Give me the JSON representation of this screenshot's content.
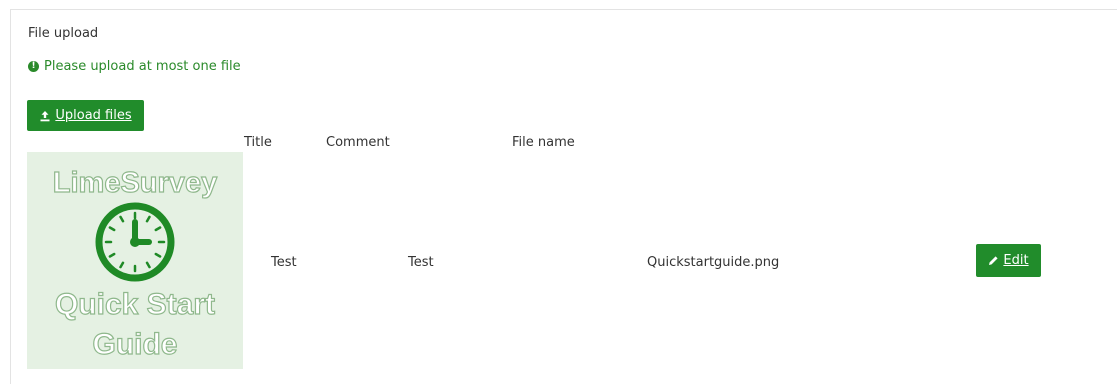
{
  "question": {
    "title": "File upload",
    "help_text": "Please upload at most one file",
    "help_icon": "exclamation-circle-icon"
  },
  "upload": {
    "button_label": "Upload files",
    "icon": "upload-icon"
  },
  "table": {
    "headers": {
      "title": "Title",
      "comment": "Comment",
      "file_name": "File name"
    },
    "rows": [
      {
        "thumbnail": {
          "line1": "LimeSurvey",
          "line2": "Quick Start",
          "line3": "Guide",
          "icon": "clock-icon"
        },
        "title": "Test",
        "comment": "Test",
        "file_name": "Quickstartguide.png",
        "edit_label": "Edit",
        "edit_icon": "pencil-icon"
      }
    ]
  },
  "colors": {
    "accent": "#218c2b",
    "help_text": "#2a8a2a",
    "thumbnail_bg": "#e5f1e3"
  }
}
